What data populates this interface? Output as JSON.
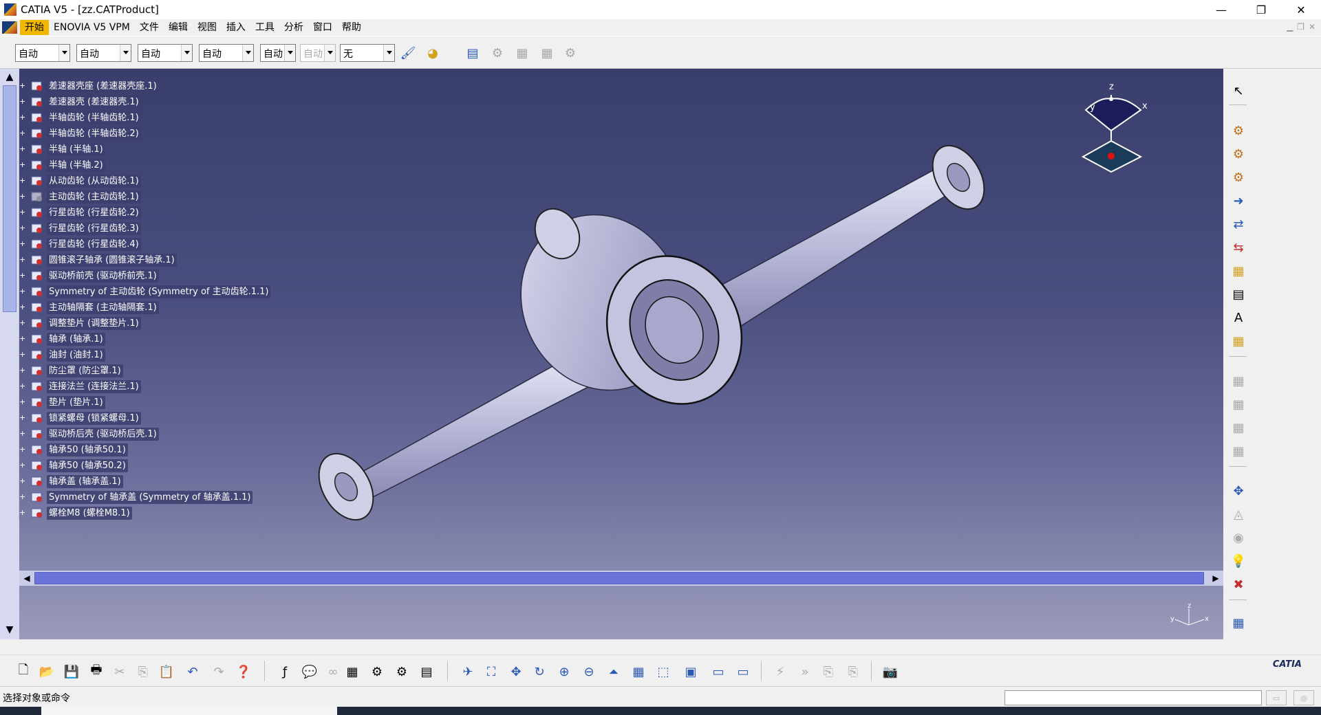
{
  "titlebar": {
    "title": "CATIA V5 - [zz.CATProduct]",
    "minimize": "—",
    "restore": "❐",
    "close": "✕"
  },
  "menubar": {
    "items": [
      "开始",
      "ENOVIA V5 VPM",
      "文件",
      "编辑",
      "视图",
      "插入",
      "工具",
      "分析",
      "窗口",
      "帮助"
    ]
  },
  "toolbar": {
    "combos": [
      "自动",
      "自动",
      "自动",
      "自动",
      "自动",
      "自动",
      "无"
    ]
  },
  "tree": {
    "items": [
      "差速器壳座 (差速器壳座.1)",
      "差速器壳 (差速器壳.1)",
      "半轴齿轮 (半轴齿轮.1)",
      "半轴齿轮 (半轴齿轮.2)",
      "半轴 (半轴.1)",
      "半轴 (半轴.2)",
      "从动齿轮 (从动齿轮.1)",
      "主动齿轮 (主动齿轮.1)",
      "行星齿轮 (行星齿轮.2)",
      "行星齿轮 (行星齿轮.3)",
      "行星齿轮 (行星齿轮.4)",
      "圆锥滚子轴承 (圆锥滚子轴承.1)",
      "驱动桥前壳 (驱动桥前壳.1)",
      "Symmetry of 主动齿轮 (Symmetry of 主动齿轮.1.1)",
      "主动轴隔套 (主动轴隔套.1)",
      "调整垫片 (调整垫片.1)",
      "轴承 (轴承.1)",
      "油封 (油封.1)",
      "防尘罩 (防尘罩.1)",
      "连接法兰 (连接法兰.1)",
      "垫片 (垫片.1)",
      "锁紧螺母 (锁紧螺母.1)",
      "驱动桥后壳 (驱动桥后壳.1)",
      "轴承50 (轴承50.1)",
      "轴承50 (轴承50.2)",
      "轴承盖 (轴承盖.1)",
      "Symmetry of 轴承盖 (Symmetry of 轴承盖.1.1)",
      "螺栓M8 (螺栓M8.1)"
    ]
  },
  "compass": {
    "x": "x",
    "y": "y",
    "z": "z"
  },
  "bottom": {
    "logo": "CATIA"
  },
  "status": {
    "text": "选择对象或命令"
  },
  "colors": {
    "menu_active": "#f2b800",
    "viewport_top": "#3a3e6c",
    "viewport_bottom": "#9a9bbb"
  }
}
